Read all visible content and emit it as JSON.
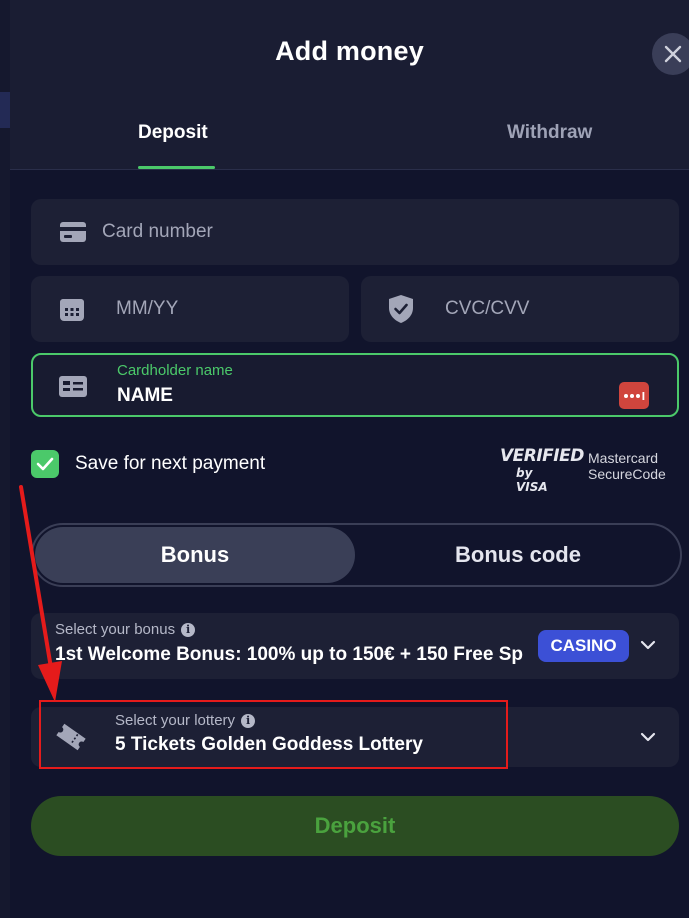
{
  "modal": {
    "title": "Add money",
    "tabs": [
      {
        "label": "Deposit",
        "active": true
      },
      {
        "label": "Withdraw",
        "active": false
      }
    ]
  },
  "form": {
    "card_number": {
      "placeholder": "Card number",
      "value": ""
    },
    "expiry": {
      "placeholder": "MM/YY",
      "value": ""
    },
    "cvc": {
      "placeholder": "CVC/CVV",
      "value": ""
    },
    "cardholder": {
      "label": "Cardholder name",
      "value": "NAME"
    },
    "save_payment": {
      "label": "Save for next payment",
      "checked": true
    }
  },
  "security_logos": {
    "verified_visa_line1": "VERIFIED",
    "verified_visa_line2": "by VISA",
    "mastercard_line1": "Mastercard",
    "mastercard_line2": "SecureCode"
  },
  "bonus_switch": {
    "options": [
      "Bonus",
      "Bonus code"
    ],
    "active": "Bonus"
  },
  "bonus_select": {
    "label": "Select your bonus",
    "value": "1st Welcome Bonus: 100% up to 150€ + 150 Free Sp",
    "badge": "CASINO"
  },
  "lottery_select": {
    "label": "Select your lottery",
    "value": "5 Tickets Golden Goddess Lottery"
  },
  "deposit_button": {
    "label": "Deposit"
  },
  "info_glyph": "i",
  "colors": {
    "accent_green": "#4bc96a",
    "badge_blue": "#3c50d6",
    "annotation_red": "#e51b1b",
    "background": "#11142c"
  }
}
